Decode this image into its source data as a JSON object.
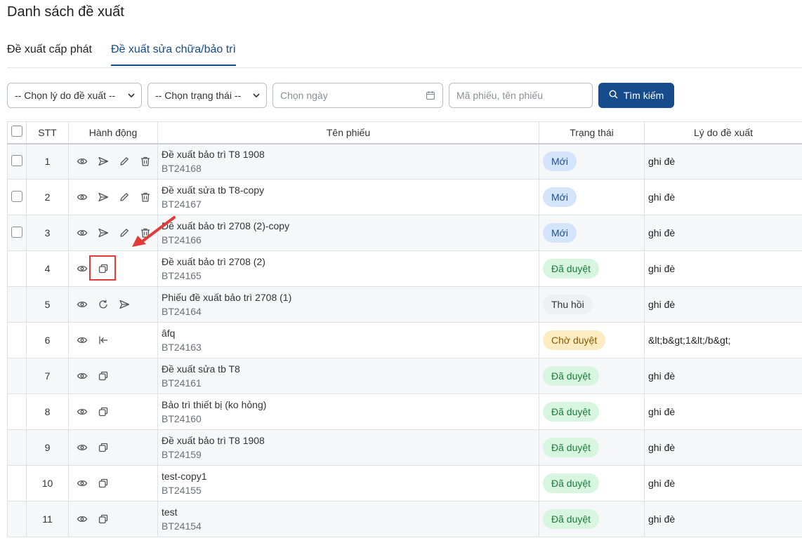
{
  "page": {
    "title": "Danh sách đề xuất"
  },
  "tabs": [
    {
      "label": "Đề xuất cấp phát",
      "active": false
    },
    {
      "label": "Đề xuất sửa chữa/bảo trì",
      "active": true
    }
  ],
  "filters": {
    "reason_select": "-- Chọn lý do đề xuất --",
    "status_select": "-- Chọn trạng thái --",
    "date_placeholder": "Chọn ngày",
    "keyword_placeholder": "Mã phiếu, tên phiếu",
    "search_label": "Tìm kiếm"
  },
  "table": {
    "headers": {
      "stt": "STT",
      "actions": "Hành động",
      "name": "Tên phiếu",
      "status": "Trạng thái",
      "reason": "Lý do đề xuất"
    },
    "rows": [
      {
        "stt": "1",
        "name": "Đề xuất bảo trì T8 1908",
        "code": "BT24168",
        "status": "Mới",
        "reason": "ghi đè",
        "actions": [
          "view",
          "send",
          "edit",
          "delete"
        ],
        "checkbox": true
      },
      {
        "stt": "2",
        "name": "Đề xuất sửa tb T8-copy",
        "code": "BT24167",
        "status": "Mới",
        "reason": "ghi đè",
        "actions": [
          "view",
          "send",
          "edit",
          "delete"
        ],
        "checkbox": true
      },
      {
        "stt": "3",
        "name": "Đề xuất bảo trì 2708 (2)-copy",
        "code": "BT24166",
        "status": "Mới",
        "reason": "ghi đè",
        "actions": [
          "view",
          "send",
          "edit",
          "delete"
        ],
        "checkbox": true
      },
      {
        "stt": "4",
        "name": "Đề xuất bảo trì 2708 (2)",
        "code": "BT24165",
        "status": "Đã duyệt",
        "reason": "ghi đè",
        "actions": [
          "view",
          "copy"
        ],
        "checkbox": false
      },
      {
        "stt": "5",
        "name": "Phiếu đề xuất bảo trì 2708 (1)",
        "code": "BT24164",
        "status": "Thu hồi",
        "reason": "ghi đè",
        "actions": [
          "view",
          "refresh",
          "send"
        ],
        "checkbox": false
      },
      {
        "stt": "6",
        "name": "âfq",
        "code": "BT24163",
        "status": "Chờ duyệt",
        "reason": "&lt;b&gt;1&lt;/b&gt;",
        "actions": [
          "view",
          "recall"
        ],
        "checkbox": false
      },
      {
        "stt": "7",
        "name": "Đề xuất sửa tb T8",
        "code": "BT24161",
        "status": "Đã duyệt",
        "reason": "ghi đè",
        "actions": [
          "view",
          "copy"
        ],
        "checkbox": false
      },
      {
        "stt": "8",
        "name": "Bảo trì thiết bị (ko hỏng)",
        "code": "BT24160",
        "status": "Đã duyệt",
        "reason": "ghi đè",
        "actions": [
          "view",
          "copy"
        ],
        "checkbox": false
      },
      {
        "stt": "9",
        "name": "Đề xuất bảo trì T8 1908",
        "code": "BT24159",
        "status": "Đã duyệt",
        "reason": "ghi đè",
        "actions": [
          "view",
          "copy"
        ],
        "checkbox": false
      },
      {
        "stt": "10",
        "name": "test-copy1",
        "code": "BT24155",
        "status": "Đã duyệt",
        "reason": "ghi đè",
        "actions": [
          "view",
          "copy"
        ],
        "checkbox": false
      },
      {
        "stt": "11",
        "name": "test",
        "code": "BT24154",
        "status": "Đã duyệt",
        "reason": "ghi đè",
        "actions": [
          "view",
          "copy"
        ],
        "checkbox": false
      }
    ]
  },
  "status_styles": {
    "Mới": "b-new",
    "Đã duyệt": "b-ok",
    "Thu hồi": "b-back",
    "Chờ duyệt": "b-wait"
  },
  "colors": {
    "primary": "#164b8c",
    "annotation": "#e33a3a"
  }
}
